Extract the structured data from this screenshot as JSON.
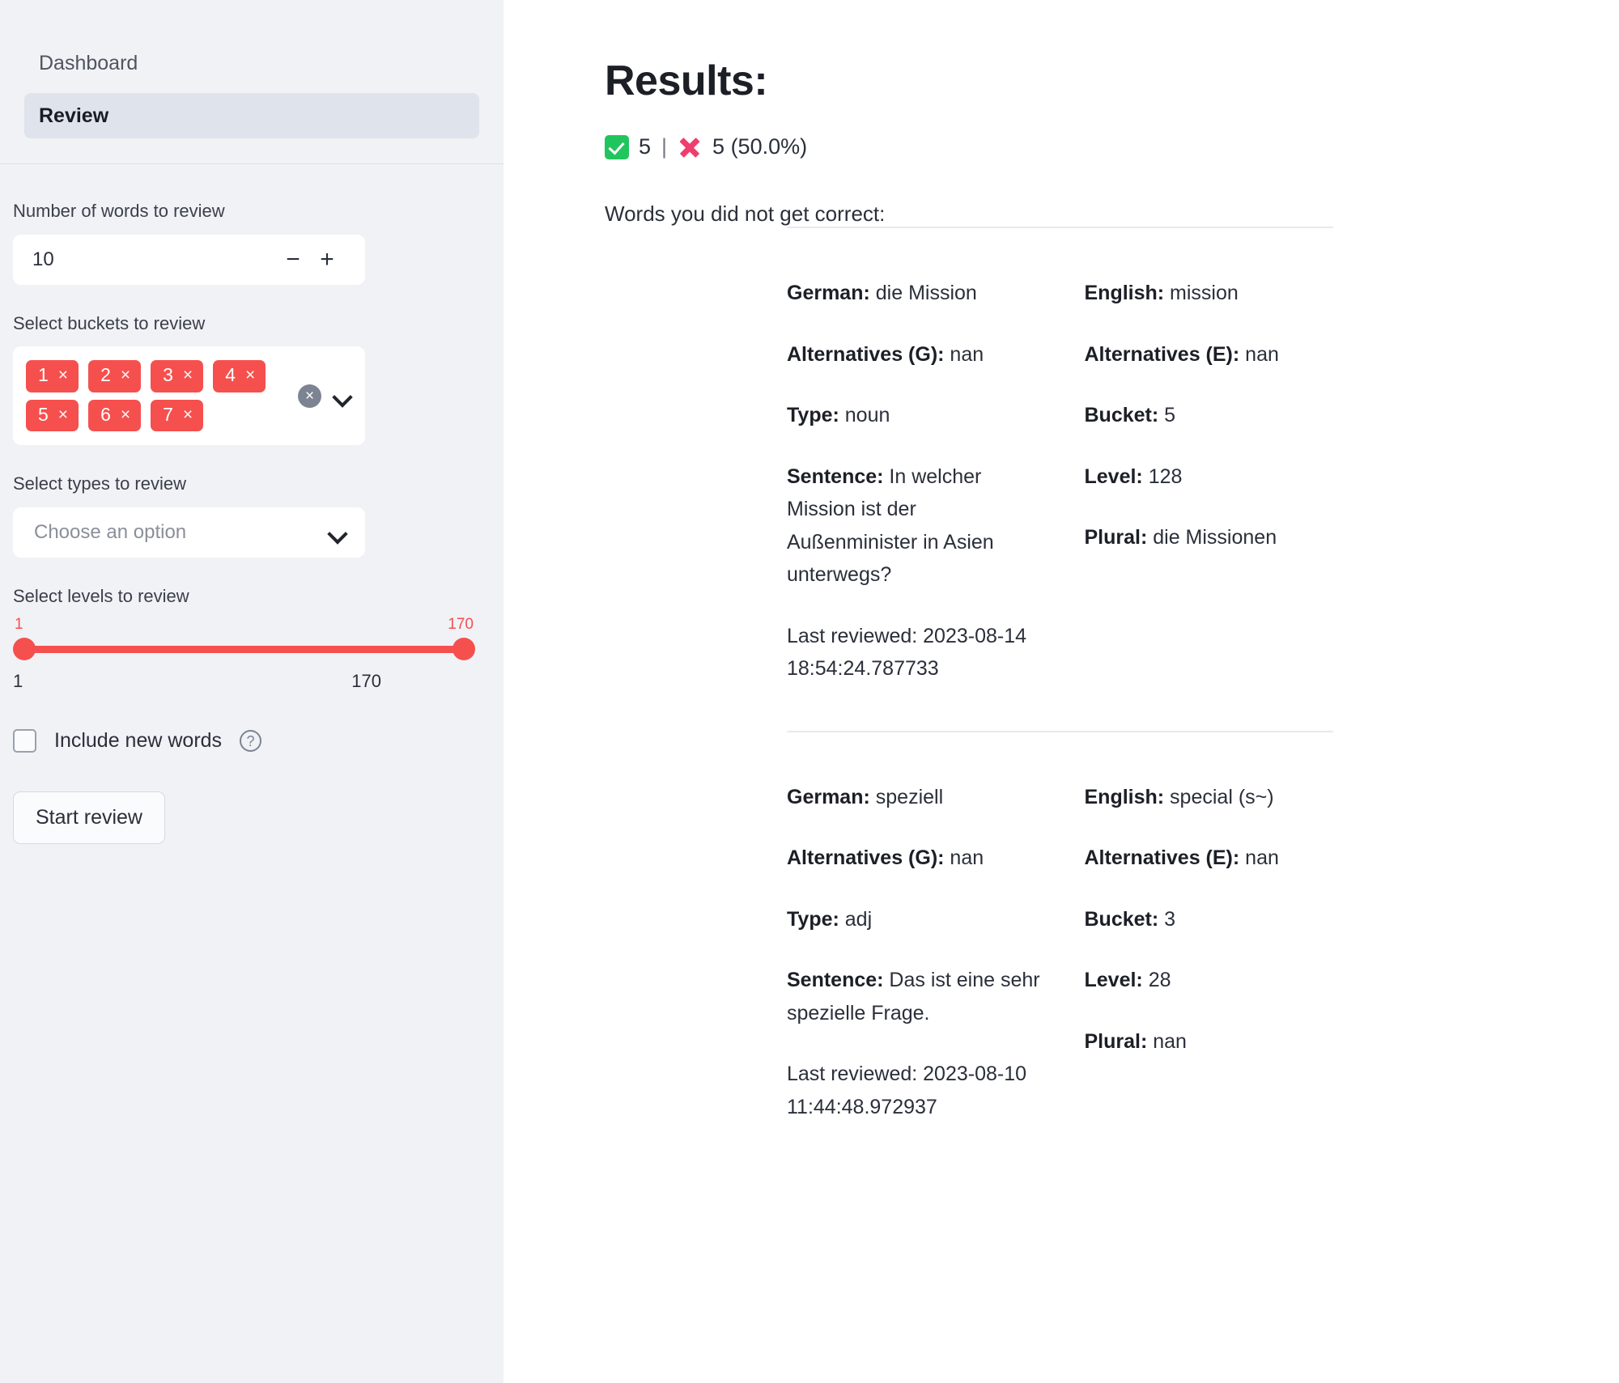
{
  "sidebar": {
    "nav": [
      {
        "label": "Dashboard",
        "active": false
      },
      {
        "label": "Review",
        "active": true
      }
    ],
    "number_of_words": {
      "label": "Number of words to review",
      "value": "10",
      "decrement": "−",
      "increment": "+"
    },
    "buckets": {
      "label": "Select buckets to review",
      "chips": [
        "1",
        "2",
        "3",
        "4",
        "5",
        "6",
        "7"
      ],
      "chip_remove": "×",
      "clear_all": "×"
    },
    "types": {
      "label": "Select types to review",
      "placeholder": "Choose an option"
    },
    "levels": {
      "label": "Select levels to review",
      "handle_min": "1",
      "handle_max": "170",
      "range_min": "1",
      "range_max": "170"
    },
    "include_new_words": {
      "label": "Include new words",
      "help": "?",
      "checked": false
    },
    "start_button": "Start review"
  },
  "main": {
    "title": "Results:",
    "score": {
      "correct": "5",
      "separator": "|",
      "incorrect": "5 (50.0%)"
    },
    "subtitle": "Words you did not get correct:",
    "labels": {
      "german": "German:",
      "english": "English:",
      "alternatives_g": "Alternatives (G):",
      "alternatives_e": "Alternatives (E):",
      "type": "Type:",
      "bucket": "Bucket:",
      "sentence": "Sentence:",
      "level": "Level:",
      "plural": "Plural:",
      "last_reviewed": "Last reviewed:"
    },
    "words": [
      {
        "german": "die Mission",
        "english": "mission",
        "alternatives_g": "nan",
        "alternatives_e": "nan",
        "type": "noun",
        "bucket": "5",
        "sentence": "In welcher Mission ist der Außenminister in Asien unterwegs?",
        "level": "128",
        "plural": "die Missionen",
        "last_reviewed": "2023-08-14 18:54:24.787733"
      },
      {
        "german": "speziell",
        "english": "special (s~)",
        "alternatives_g": "nan",
        "alternatives_e": "nan",
        "type": "adj",
        "bucket": "3",
        "sentence": "Das ist eine sehr spezielle Frage.",
        "level": "28",
        "plural": "nan",
        "last_reviewed": "2023-08-10 11:44:48.972937"
      }
    ]
  },
  "colors": {
    "sidebar_bg": "#f0f2f6",
    "chip_red": "#f5504e",
    "slider_red": "#f5504e",
    "check_green": "#21c55d",
    "cross_pink": "#ef3e6d",
    "active_nav_bg": "#dfe3eb"
  }
}
